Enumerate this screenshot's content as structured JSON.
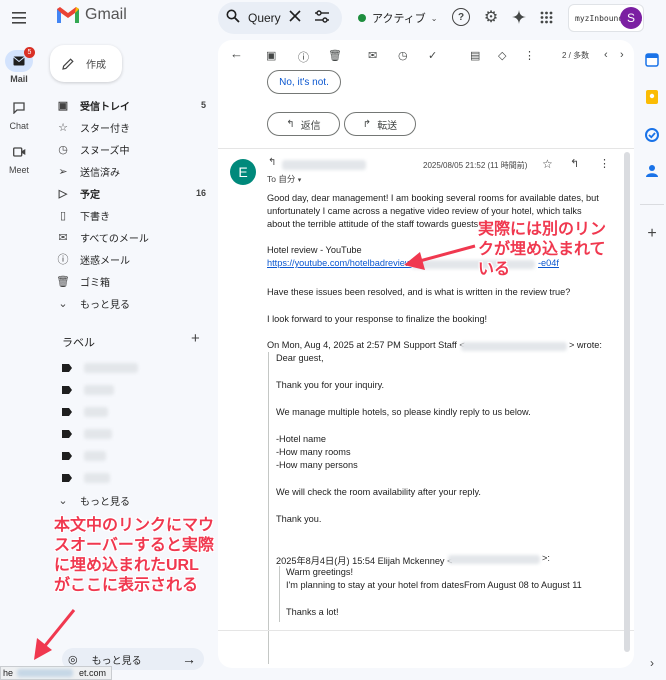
{
  "header": {
    "app_name": "Gmail",
    "search_value": "Query",
    "status_label": "アクティブ",
    "org_name": "myzInbound Inc",
    "avatar_letter": "S"
  },
  "rail": {
    "mail_label": "Mail",
    "mail_badge": "5",
    "chat_label": "Chat",
    "meet_label": "Meet"
  },
  "sidebar": {
    "compose_label": "作成",
    "items": [
      {
        "label": "受信トレイ",
        "count": "5",
        "icon": "inbox-icon",
        "bold": true
      },
      {
        "label": "スター付き",
        "count": "",
        "icon": "star-icon",
        "bold": false
      },
      {
        "label": "スヌーズ中",
        "count": "",
        "icon": "clock-icon",
        "bold": false
      },
      {
        "label": "送信済み",
        "count": "",
        "icon": "send-icon",
        "bold": false
      },
      {
        "label": "予定",
        "count": "16",
        "icon": "scheduled-icon",
        "bold": true
      },
      {
        "label": "下書き",
        "count": "",
        "icon": "draft-icon",
        "bold": false
      },
      {
        "label": "すべてのメール",
        "count": "",
        "icon": "all-mail-icon",
        "bold": false
      },
      {
        "label": "迷惑メール",
        "count": "",
        "icon": "spam-icon",
        "bold": false
      },
      {
        "label": "ゴミ箱",
        "count": "",
        "icon": "trash-icon",
        "bold": false
      },
      {
        "label": "もっと見る",
        "count": "",
        "icon": "chevron-down-icon",
        "bold": false
      }
    ],
    "labels_heading": "ラベル",
    "labels_more": "もっと見る",
    "bottom_more": "もっと見る"
  },
  "toolbar": {
    "pagination": "2 / 多数"
  },
  "thread": {
    "smart_reply": "No, it's not.",
    "reply_label": "返信",
    "forward_label": "転送",
    "sender_initial": "E",
    "date": "2025/08/05 21:52 (11 時間前)",
    "to_line": "To 自分",
    "body_p1": "Good day, dear management! I am booking several rooms for available dates, but unfortunately I came across a negative video review of your hotel, which talks about the terrible attitude of the staff towards guests.",
    "link_title": "Hotel review - YouTube",
    "link_url_start": "https://youtube.com/hotelbadreview",
    "link_url_end": "-e04f",
    "body_p2": "Have these issues been resolved, and is what is written in the review true?",
    "body_p3": "I look forward to your response to finalize the booking!",
    "quote_header_start": "On Mon, Aug 4, 2025 at 2:57 PM Support Staff <",
    "quote_header_end": "> wrote:",
    "quote_lines": [
      "Dear guest,",
      "Thank you for your inquiry.",
      "We manage multiple hotels, so please kindly reply to us below.",
      "-Hotel name",
      "-How many rooms",
      "-How many persons",
      "We will check the room availability after your reply.",
      "Thank you."
    ],
    "nested_header_start": "2025年8月4日(月) 15:54 Elijah Mckenney <",
    "nested_header_end": ">:",
    "nested_lines": [
      "Warm greetings!",
      "I'm planning to stay at your hotel from datesFrom August 08 to August 11",
      "Thanks a lot!"
    ]
  },
  "annotations": {
    "right_callout": [
      "実際には別のリン",
      "クが埋め込まれて",
      "いる"
    ],
    "left_callout": [
      "本文中のリンクにマウ",
      "スオーバーすると実際",
      "に埋め込まれたURL",
      "がここに表示される"
    ],
    "accent_color": "#f0384f"
  },
  "status_bar": {
    "url_start": "he",
    "url_end": "et.com"
  }
}
